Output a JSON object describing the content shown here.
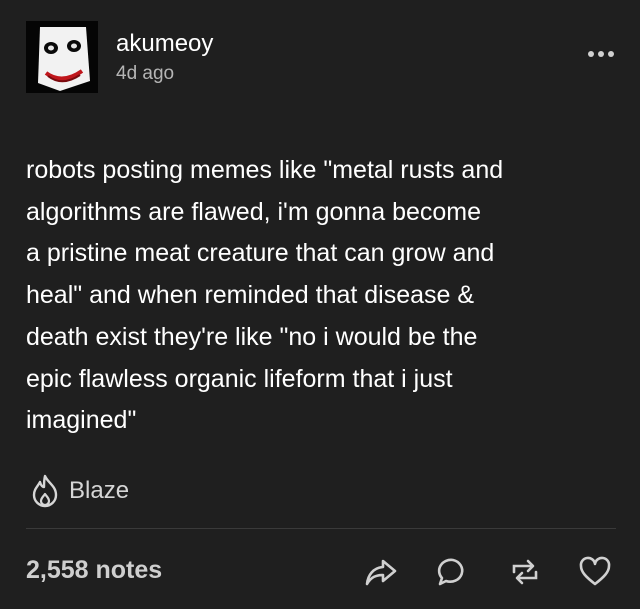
{
  "post": {
    "username": "akumeoy",
    "timestamp": "4d ago",
    "more_icon": "ellipsis-icon",
    "avatar_icon": "masked-face-avatar",
    "body": "robots posting memes like \"metal rusts and\nalgorithms are flawed, i'm gonna become\na pristine meat creature that can grow and\nheal\" and when reminded that disease &\ndeath exist they're like \"no i would be the\nepic flawless organic lifeform that i just\nimagined\"",
    "blaze_label": "Blaze",
    "blaze_icon": "flame-icon"
  },
  "footer": {
    "notes": "2,558 notes",
    "actions": [
      "share-icon",
      "reply-icon",
      "reblog-icon",
      "like-icon"
    ]
  },
  "colors": {
    "background": "#1f1f1f",
    "text": "#ffffff",
    "muted": "#b5b5b5",
    "divider": "#3a3a3a"
  }
}
